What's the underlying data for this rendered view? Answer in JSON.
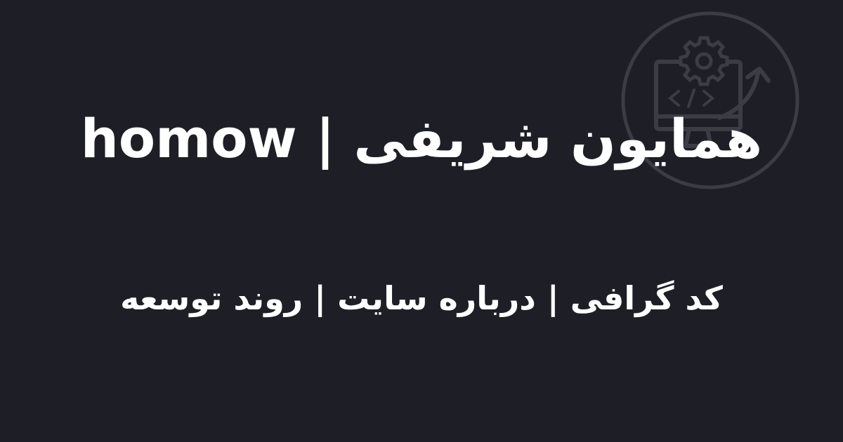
{
  "title": "همایون شریفی | homow",
  "subtitle": "کد گرافی | درباره سایت | روند توسعه",
  "colors": {
    "background": "#1e1f26",
    "text": "#ffffff",
    "logo_stroke": "#3b3c44"
  },
  "icons": {
    "logo": "code-development-gear-arrow-icon"
  }
}
